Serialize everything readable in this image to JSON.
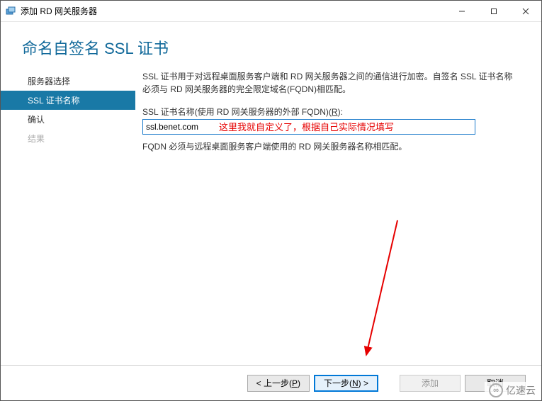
{
  "titlebar": {
    "title": "添加 RD 网关服务器"
  },
  "header": {
    "page_title": "命名自签名 SSL 证书"
  },
  "sidebar": {
    "items": [
      {
        "label": "服务器选择",
        "state": "normal"
      },
      {
        "label": "SSL 证书名称",
        "state": "active"
      },
      {
        "label": "确认",
        "state": "normal"
      },
      {
        "label": "结果",
        "state": "muted"
      }
    ]
  },
  "main": {
    "description": "SSL 证书用于对远程桌面服务客户端和 RD 网关服务器之间的通信进行加密。自签名 SSL 证书名称必须与 RD 网关服务器的完全限定域名(FQDN)相匹配。",
    "field_label_prefix": "SSL 证书名称(使用 RD 网关服务器的外部 FQDN)(",
    "field_label_accel": "R",
    "field_label_suffix": "):",
    "input_value": "ssl.benet.com",
    "annotation": "这里我就自定义了，根据自己实际情况填写",
    "hint": "FQDN 必须与远程桌面服务客户端使用的 RD 网关服务器名称相匹配。"
  },
  "footer": {
    "prev_label_prefix": "< 上一步(",
    "prev_accel": "P",
    "prev_label_suffix": ")",
    "next_label_prefix": "下一步(",
    "next_accel": "N",
    "next_label_suffix": ") >",
    "add_label": "添加",
    "cancel_label": "取消"
  },
  "watermark": {
    "text": "亿速云"
  }
}
